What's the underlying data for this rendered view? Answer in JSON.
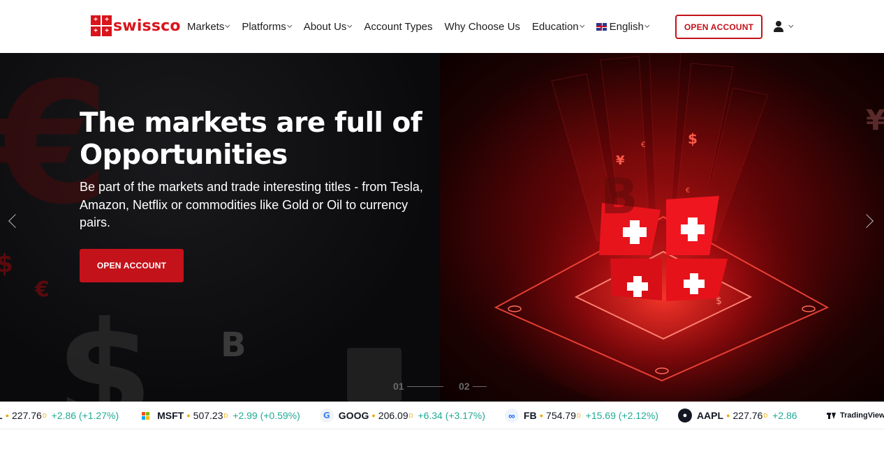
{
  "brand": {
    "name": "swissco",
    "color": "#d9141b"
  },
  "nav": {
    "items": [
      {
        "label": "Markets",
        "has_dropdown": true
      },
      {
        "label": "Platforms",
        "has_dropdown": true
      },
      {
        "label": "About Us",
        "has_dropdown": true
      },
      {
        "label": "Account Types",
        "has_dropdown": false
      },
      {
        "label": "Why Choose Us",
        "has_dropdown": false
      },
      {
        "label": "Education",
        "has_dropdown": true
      }
    ],
    "language": {
      "label": "English",
      "flag": "uk-flag-icon"
    },
    "open_account_label": "OPEN ACCOUNT",
    "user_icon": "user-icon"
  },
  "hero": {
    "title": "The markets are full of Opportunities",
    "subtitle": "Be part of the markets and trade interesting titles - from Tesla, Amazon, Netflix or commodities like Gold or Oil to currency pairs.",
    "cta_label": "OPEN ACCOUNT",
    "accent": "#c4121a",
    "slides": [
      {
        "number": "01"
      },
      {
        "number": "02"
      }
    ],
    "active_slide": 1
  },
  "ticker": {
    "items": [
      {
        "symbol": "AAPL",
        "symbol_visible": "L",
        "price": "227.76",
        "change": "+2.86 (+1.27%)",
        "icon": "apple-icon"
      },
      {
        "symbol": "MSFT",
        "price": "507.23",
        "change": "+2.99 (+0.59%)",
        "icon": "microsoft-icon"
      },
      {
        "symbol": "GOOG",
        "price": "206.09",
        "change": "+6.34 (+3.17%)",
        "icon": "google-icon"
      },
      {
        "symbol": "FB",
        "price": "754.79",
        "change": "+15.69 (+2.12%)",
        "icon": "meta-icon"
      },
      {
        "symbol": "AAPL",
        "price": "227.76",
        "change": "+2.86",
        "icon": "apple-icon"
      }
    ],
    "delay_marker": "D",
    "provider": "TradingView",
    "up_color": "#22ab94"
  }
}
